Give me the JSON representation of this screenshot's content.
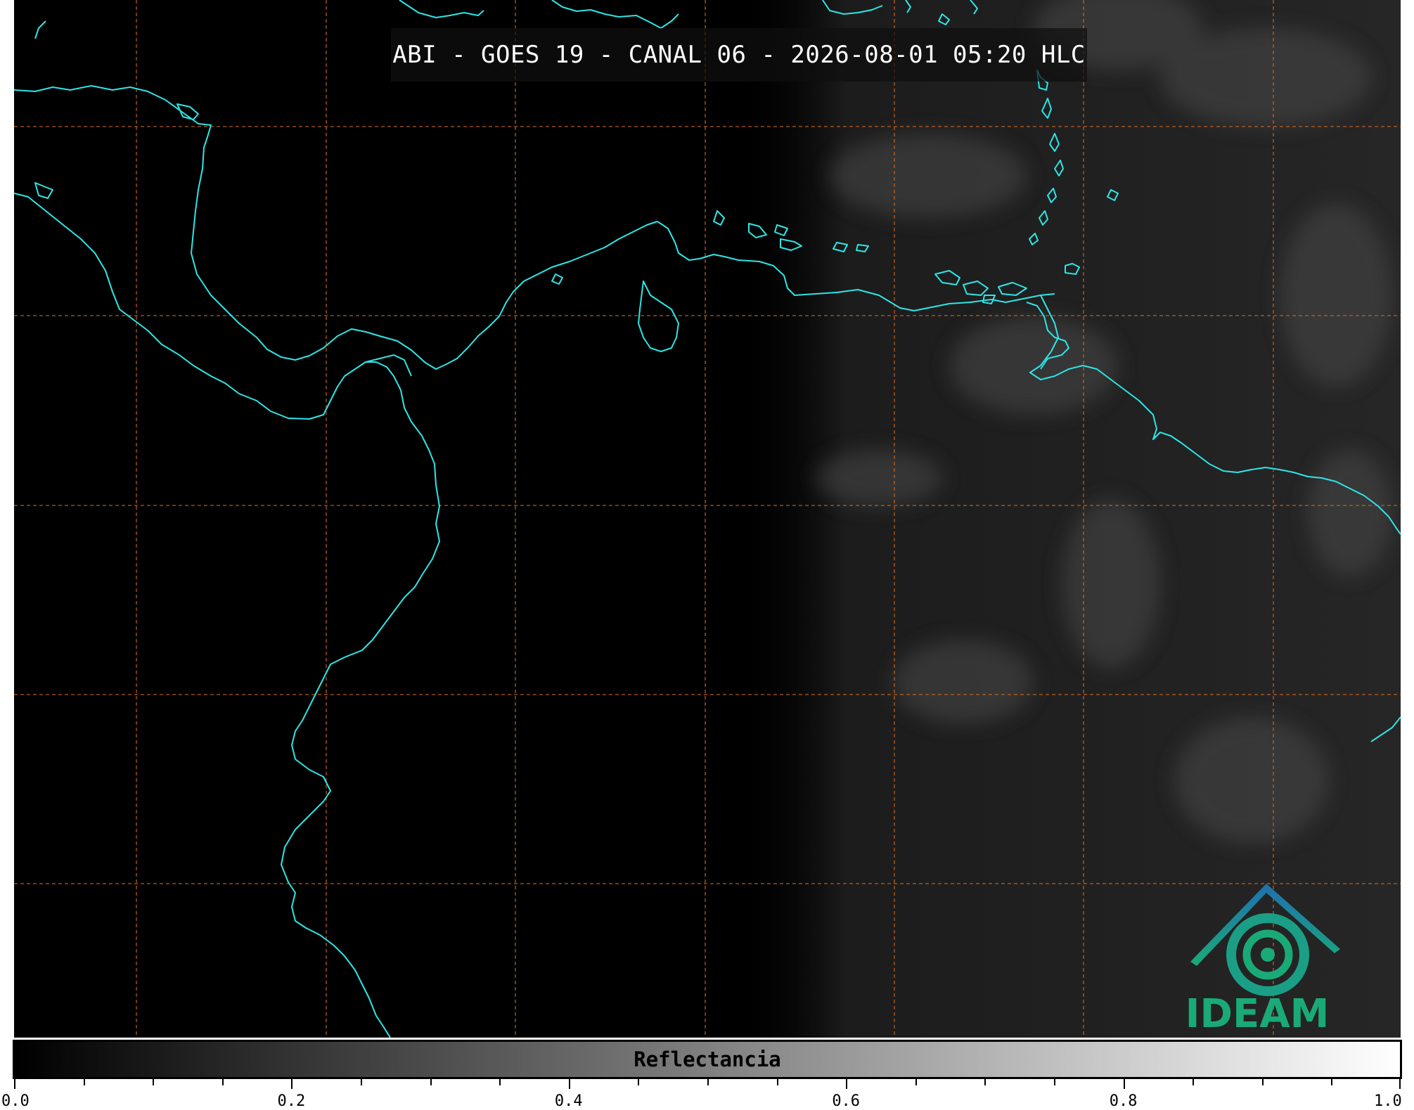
{
  "title": "ABI - GOES 19 - CANAL 06 - 2026-08-01 05:20 HLC",
  "colorbar": {
    "label": "Reflectancia",
    "min": 0.0,
    "max": 1.0,
    "major_ticks": [
      "0.0",
      "0.2",
      "0.4",
      "0.6",
      "0.8",
      "1.0"
    ],
    "minor_tick_step": 0.05
  },
  "logo": {
    "text": "IDEAM"
  },
  "colors": {
    "coastline": "#2ee6e6",
    "gridline": "#d2691e",
    "background": "#000000",
    "logo_green": "#1aaa78",
    "logo_blue": "#1f6fb0"
  }
}
